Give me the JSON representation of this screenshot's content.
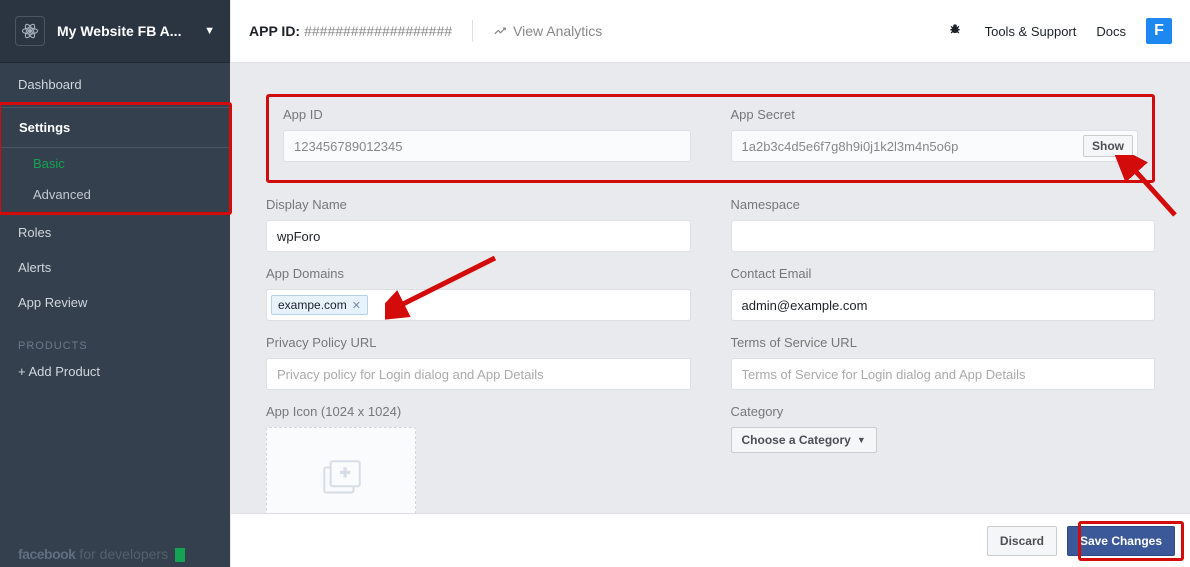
{
  "sidebar": {
    "app_name": "My Website FB A...",
    "items": {
      "dashboard": "Dashboard",
      "settings": "Settings",
      "basic": "Basic",
      "advanced": "Advanced",
      "roles": "Roles",
      "alerts": "Alerts",
      "review": "App Review"
    },
    "products_label": "PRODUCTS",
    "add_product": "+ Add Product",
    "footer_brand": "facebook",
    "footer_suffix": "for developers"
  },
  "topbar": {
    "appid_label": "APP ID:",
    "appid_value": "###################",
    "analytics": "View Analytics",
    "tools": "Tools & Support",
    "docs": "Docs",
    "avatar_letter": "F"
  },
  "fields": {
    "app_id_label": "App ID",
    "app_id_value": "123456789012345",
    "app_secret_label": "App Secret",
    "app_secret_value": "1a2b3c4d5e6f7g8h9i0j1k2l3m4n5o6p",
    "show_btn": "Show",
    "display_name_label": "Display Name",
    "display_name_value": "wpForo",
    "namespace_label": "Namespace",
    "namespace_value": "",
    "app_domains_label": "App Domains",
    "domain_tag": "exampe.com",
    "contact_email_label": "Contact Email",
    "contact_email_value": "admin@example.com",
    "privacy_label": "Privacy Policy URL",
    "privacy_placeholder": "Privacy policy for Login dialog and App Details",
    "terms_label": "Terms of Service URL",
    "terms_placeholder": "Terms of Service for Login dialog and App Details",
    "icon_label": "App Icon (1024 x 1024)",
    "icon_dim": "1024 x 1024",
    "category_label": "Category",
    "category_value": "Choose a Category"
  },
  "footer": {
    "discard": "Discard",
    "save": "Save Changes"
  }
}
